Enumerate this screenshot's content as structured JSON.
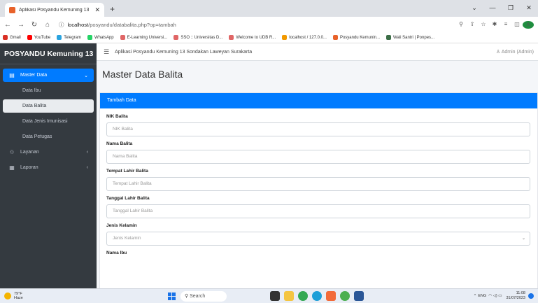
{
  "browser": {
    "tab_title": "Aplikasi Posyandu Kemuning 13",
    "url_host": "localhost",
    "url_path": "/posyandu/databalita.php?op=tambah",
    "bookmarks": [
      {
        "label": "Gmail",
        "color": "#d93025"
      },
      {
        "label": "YouTube",
        "color": "#ff0000"
      },
      {
        "label": "Telegram",
        "color": "#2aa3df"
      },
      {
        "label": "WhatsApp",
        "color": "#25d366"
      },
      {
        "label": "E-Learning Universi...",
        "color": "#e06666"
      },
      {
        "label": "SSO :: Universitas D...",
        "color": "#e06666"
      },
      {
        "label": "Welcome to UDB R...",
        "color": "#e06666"
      },
      {
        "label": "localhost / 127.0.0...",
        "color": "#f29900"
      },
      {
        "label": "Posyandu Kemunin...",
        "color": "#e8622a"
      },
      {
        "label": "Wali Santri | Ponpes...",
        "color": "#3c6e47"
      }
    ],
    "profile_initial": "A"
  },
  "sidebar": {
    "brand": "POSYANDU Kemuning 13",
    "items": [
      {
        "label": "Master Data",
        "icon": "database-icon",
        "glyph": "▤",
        "chevron": "⌄"
      },
      {
        "label": "Data Ibu"
      },
      {
        "label": "Data Balita"
      },
      {
        "label": "Data Jenis Imunisasi"
      },
      {
        "label": "Data Petugas"
      },
      {
        "label": "Layanan",
        "icon": "hand-icon",
        "glyph": "♲",
        "chevron": "‹"
      },
      {
        "label": "Laporan",
        "icon": "report-icon",
        "glyph": "▦",
        "chevron": "‹"
      }
    ]
  },
  "topbar": {
    "title": "Aplikasi Posyandu Kemuning 13 Sondakan Laweyan Surakarta",
    "user": "Admin (Admin)"
  },
  "page": {
    "title": "Master Data Balita",
    "card_title": "Tambah Data"
  },
  "form": {
    "fields": [
      {
        "label": "NIK Balita",
        "placeholder": "NIK Balita"
      },
      {
        "label": "Nama Balita",
        "placeholder": "Nama Balita"
      },
      {
        "label": "Tempat Lahir Balita",
        "placeholder": "Tempat Lahir Balita"
      },
      {
        "label": "Tanggal Lahir Balita",
        "placeholder": "Tanggal Lahir Balita"
      },
      {
        "label": "Jenis Kelamin",
        "placeholder": "Jenis Kelamin"
      },
      {
        "label": "Nama Ibu"
      }
    ]
  },
  "taskbar": {
    "temp": "79°F",
    "weather": "Haze",
    "search": "Search",
    "lang": "ENG",
    "time": "11:08",
    "date": "31/07/2023"
  },
  "colors": {
    "primary": "#007bff",
    "sidebar_bg": "#343a40"
  }
}
